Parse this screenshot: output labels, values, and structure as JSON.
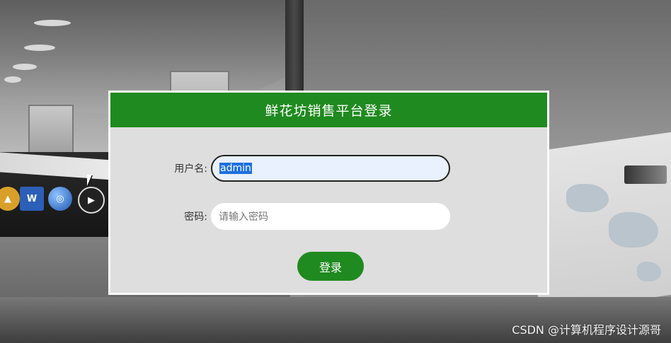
{
  "login": {
    "title": "鲜花坊销售平台登录",
    "username_label": "用户名:",
    "username_value": "admin",
    "password_label": "密码:",
    "password_placeholder": "请输入密码",
    "submit_label": "登录"
  },
  "watermark": "CSDN @计算机程序设计源哥",
  "colors": {
    "accent": "#1f8a1f",
    "panel_bg": "#dedede",
    "focused_field_bg": "#e8f1fd",
    "selection": "#1c6fe0"
  },
  "background_icons": [
    "word-icon",
    "globe-icon",
    "play-icon"
  ]
}
